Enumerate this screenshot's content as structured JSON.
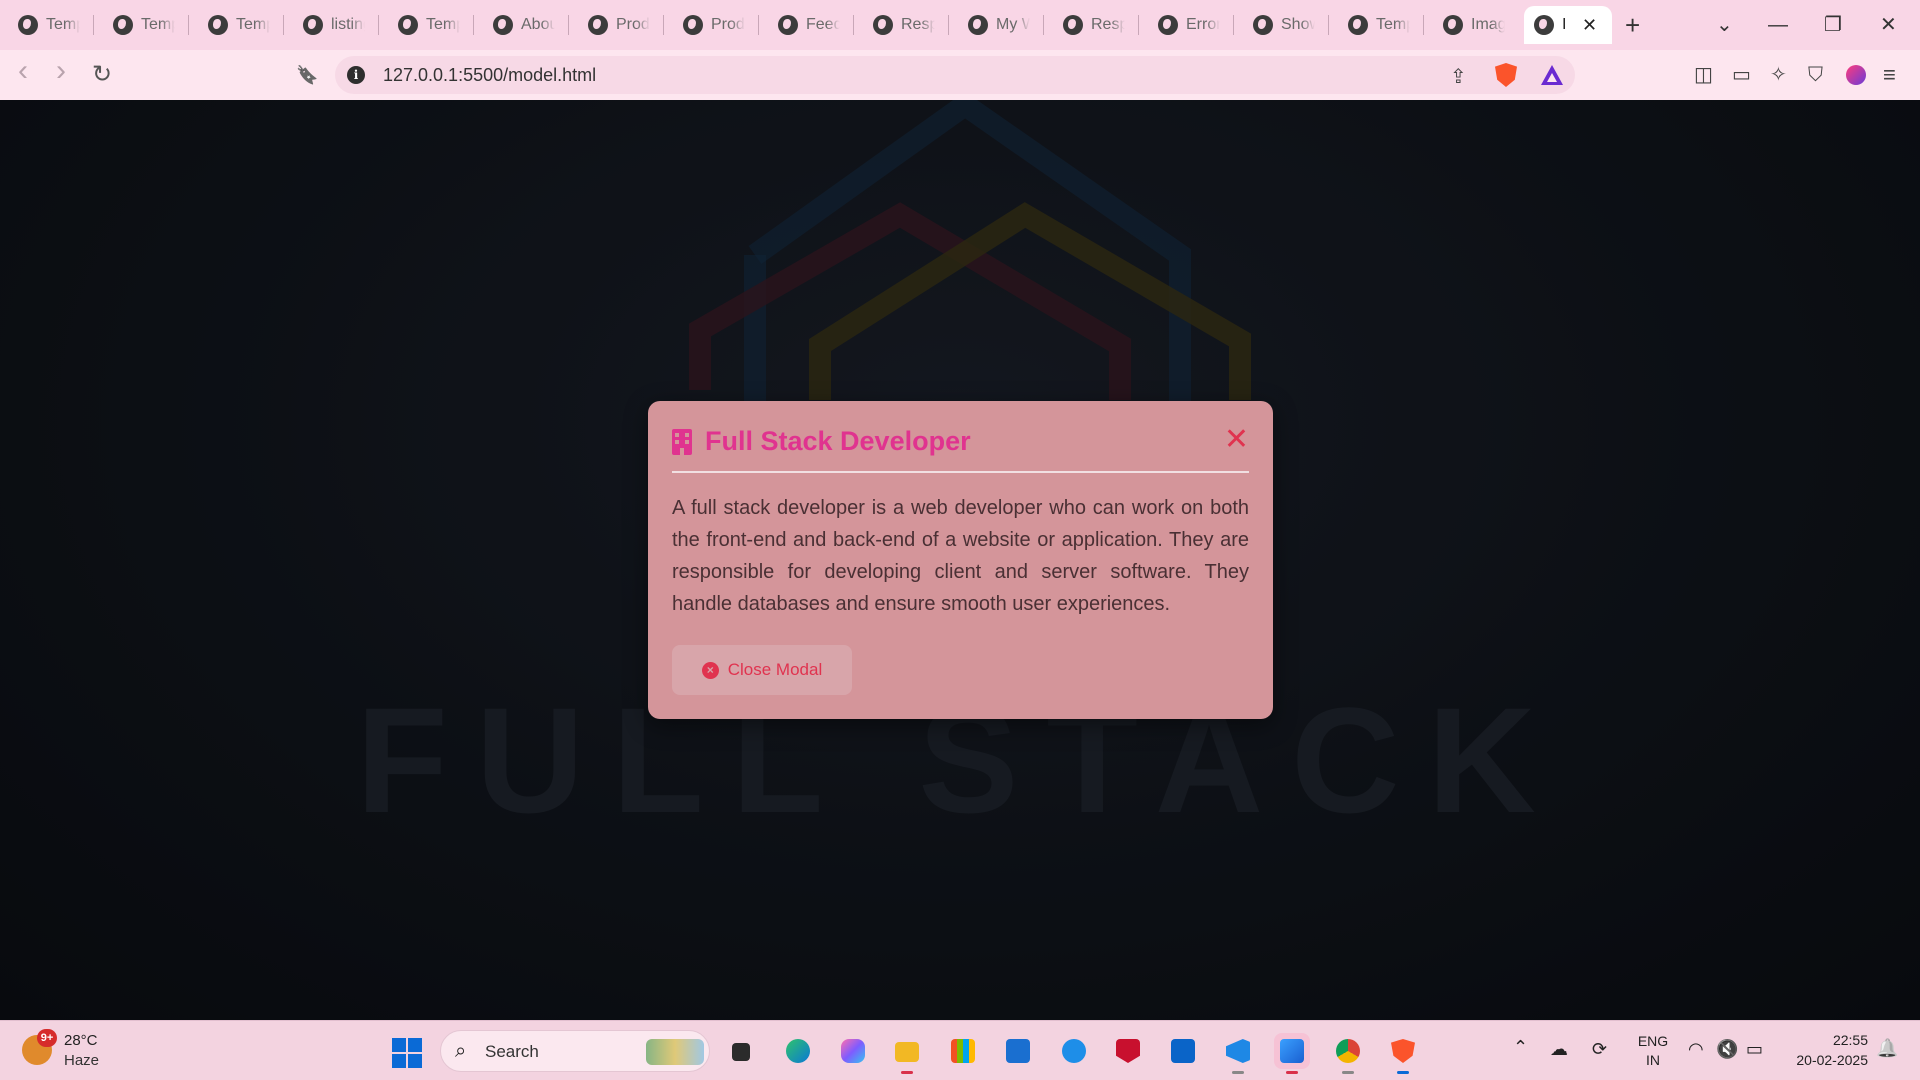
{
  "browser": {
    "tabs": [
      {
        "label": "Temp"
      },
      {
        "label": "Temp"
      },
      {
        "label": "Temp"
      },
      {
        "label": "listing"
      },
      {
        "label": "Temp"
      },
      {
        "label": "About"
      },
      {
        "label": "Prod"
      },
      {
        "label": "Prod"
      },
      {
        "label": "Feedb"
      },
      {
        "label": "Resp"
      },
      {
        "label": "My W"
      },
      {
        "label": "Resp"
      },
      {
        "label": "Error"
      },
      {
        "label": "Show"
      },
      {
        "label": "Temp"
      },
      {
        "label": "Imag"
      }
    ],
    "active_tab": {
      "label": "I",
      "close": "✕"
    },
    "new_tab": "+",
    "address": {
      "url": "127.0.0.1:5500/model.html",
      "info": "i"
    },
    "window_controls": {
      "dropdown": "⌄",
      "minimize": "—",
      "restore": "❐",
      "close": "✕"
    },
    "nav": {
      "back": "‹",
      "forward": "›",
      "reload": "↻",
      "bookmark": "🔖"
    },
    "tools": {
      "share": "⇪",
      "sidebar": "◫",
      "wallet": "▭",
      "leo": "✧",
      "vpn": "⛉",
      "menu": "≡"
    }
  },
  "page": {
    "background_word": "FULL STACK",
    "modal": {
      "title": "Full Stack Developer",
      "close_symbol": "✕",
      "body": "A full stack developer is a web developer who can work on both the front-end and back-end of a website or application. They are responsible for developing client and server software. They handle databases and ensure smooth user experiences.",
      "button_label": "Close Modal",
      "button_icon": "×",
      "accent_color": "#e0338f",
      "danger_color": "#e0334f"
    }
  },
  "taskbar": {
    "weather": {
      "temp": "28°C",
      "desc": "Haze",
      "badge": "9+"
    },
    "search": {
      "glyph": "⌕",
      "placeholder": "Search"
    },
    "apps": [
      {
        "name": "task-view"
      },
      {
        "name": "edge"
      },
      {
        "name": "copilot"
      },
      {
        "name": "file-explorer"
      },
      {
        "name": "microsoft-store"
      },
      {
        "name": "myhp"
      },
      {
        "name": "help"
      },
      {
        "name": "mcafee"
      },
      {
        "name": "outlook"
      },
      {
        "name": "vscode"
      },
      {
        "name": "photos"
      },
      {
        "name": "chrome"
      },
      {
        "name": "brave"
      }
    ],
    "tray": {
      "chevron": "⌃",
      "lang_line1": "ENG",
      "lang_line2": "IN",
      "wifi": "◠",
      "volume": "🔇",
      "battery": "▭"
    },
    "clock": {
      "time": "22:55",
      "date": "20-02-2025"
    },
    "notification": "🔔"
  }
}
